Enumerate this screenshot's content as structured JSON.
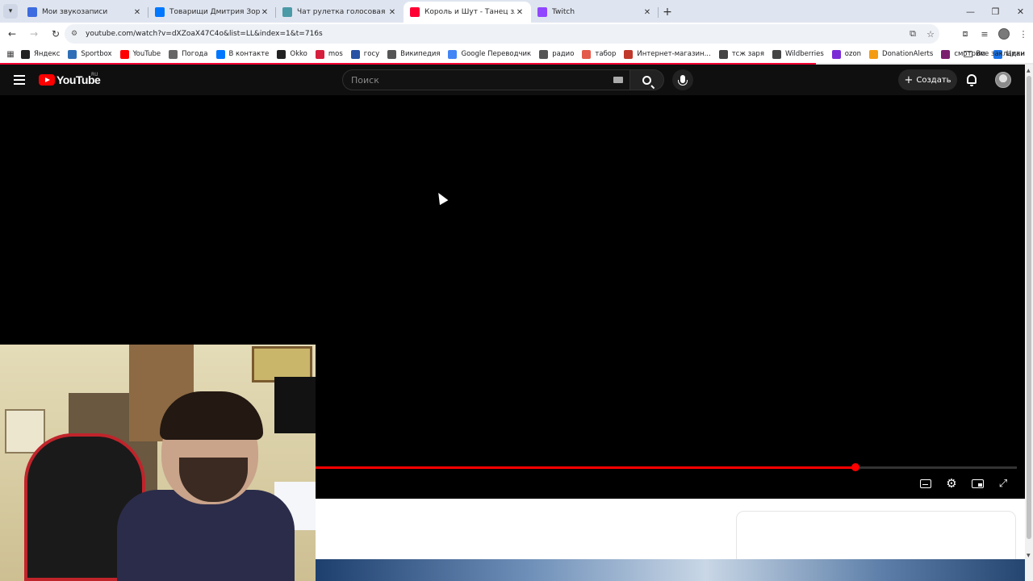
{
  "browser": {
    "tabs": [
      {
        "title": "Мои звукозаписи",
        "favicon_color": "#3d6ce0"
      },
      {
        "title": "Товарищи Дмитрия Зорина – ",
        "favicon_color": "#0077ff"
      },
      {
        "title": "Чат рулетка голосовая — Nek",
        "favicon_color": "#4a9aa8"
      },
      {
        "title": "Король и Шут - Танец злобно",
        "favicon_color": "#ff0033"
      },
      {
        "title": "Twitch",
        "favicon_color": "#9146ff"
      }
    ],
    "active_tab_index": 3,
    "url": "youtube.com/watch?v=dXZoaX47C4o&list=LL&index=1&t=716s",
    "bookmarks": [
      {
        "label": "Яндекс",
        "color": "#222222"
      },
      {
        "label": "Sportbox",
        "color": "#2e6fb8"
      },
      {
        "label": "YouTube",
        "color": "#ff0000"
      },
      {
        "label": "Погода",
        "color": "#666666"
      },
      {
        "label": "В контакте",
        "color": "#0077ff"
      },
      {
        "label": "Okko",
        "color": "#222222"
      },
      {
        "label": "mos",
        "color": "#d61f3d"
      },
      {
        "label": "госу",
        "color": "#2951a3"
      },
      {
        "label": "Википедия",
        "color": "#555555"
      },
      {
        "label": "Google Переводчик",
        "color": "#4285f4"
      },
      {
        "label": "радио",
        "color": "#555555"
      },
      {
        "label": "табор",
        "color": "#e35a4a"
      },
      {
        "label": "Интернет-магазин...",
        "color": "#c0392b"
      },
      {
        "label": "тсж заря",
        "color": "#444444"
      },
      {
        "label": "Wildberries",
        "color": "#444444"
      },
      {
        "label": "ozon",
        "color": "#7b2bd6"
      },
      {
        "label": "DonationAlerts",
        "color": "#f39c12"
      },
      {
        "label": "смотрим",
        "color": "#7a1f6e"
      },
      {
        "label": "Циан",
        "color": "#1a73e8"
      }
    ],
    "all_bookmarks_label": "Все закладки",
    "page_load_progress": 0.79
  },
  "youtube": {
    "logo_text": "YouTube",
    "region": "RU",
    "search_placeholder": "Поиск",
    "create_label": "Создать",
    "accent_color": "#ff0000"
  },
  "player": {
    "progress": 0.77
  }
}
